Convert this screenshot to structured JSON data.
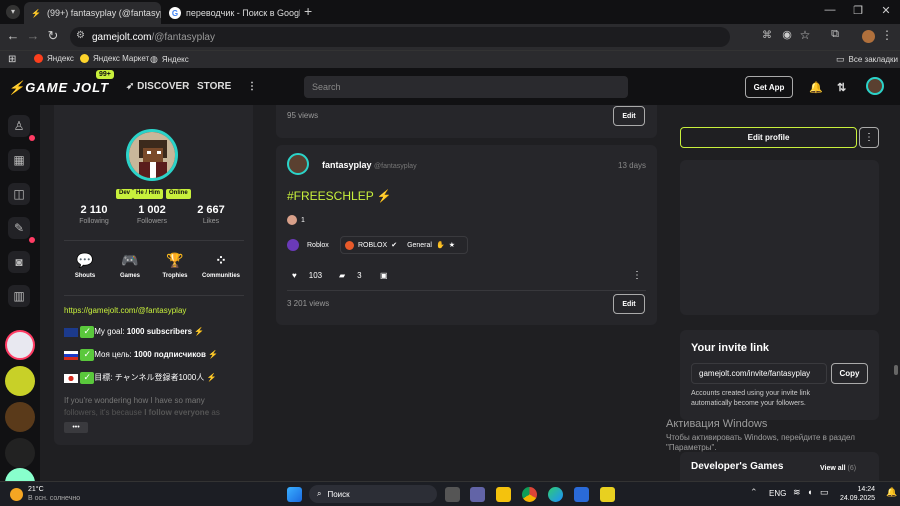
{
  "browser": {
    "tabs": [
      {
        "label": "(99+) fantasyplay (@fantasypla",
        "icon": "gamejolt-icon"
      },
      {
        "label": "переводчик - Поиск в Google",
        "icon": "google-icon"
      }
    ],
    "new_tab": "+",
    "url": "gamejolt.com/@fantasyplay",
    "url_host": "gamejolt.com",
    "url_path": "/@fantasyplay",
    "bookmarks": [
      "Яндекс",
      "Яндекс Маркет",
      "Яндекс"
    ],
    "all_bookmarks": "Все закладки"
  },
  "site": {
    "logo": "GAME JOLT",
    "logo_badge": "99+",
    "nav": [
      "DISCOVER",
      "STORE"
    ],
    "search_placeholder": "Search",
    "get_app": "Get App"
  },
  "profile": {
    "tags": [
      "Dev",
      "He / Him",
      "Online"
    ],
    "stats": [
      {
        "value": "2 110",
        "label": "Following"
      },
      {
        "value": "1 002",
        "label": "Followers"
      },
      {
        "value": "2 667",
        "label": "Likes"
      }
    ],
    "buttons": [
      "Shouts",
      "Games",
      "Trophies",
      "Communities"
    ],
    "link": "https://gamejolt.com/@fantasyplay",
    "bio_lines": [
      {
        "prefix": "My goal: ",
        "bold": "1000 subscribers"
      },
      {
        "prefix": "Моя цель: ",
        "bold": "1000 подписчиков"
      },
      {
        "prefix": "目標: ",
        "bold": "チャンネル登録者1000人"
      }
    ],
    "bio_more_1": "If you're wondering how I have so many",
    "bio_more_2a": "followers, it's because ",
    "bio_more_2b": "I follow everyone",
    "bio_more_2c": " as",
    "more_btn": "•••"
  },
  "feed": {
    "post0": {
      "views": "95 views",
      "edit": "Edit"
    },
    "post1": {
      "author": "fantasyplay",
      "handle": "@fantasyplay",
      "time": "13 days",
      "text": "#FREESCHLEP",
      "reaction_count": "1",
      "community_1": "Roblox",
      "community_2": "ROBLOX",
      "channel": "General",
      "likes": "103",
      "comments": "3",
      "views": "3 201 views",
      "edit": "Edit"
    }
  },
  "right": {
    "edit_profile": "Edit profile",
    "invite_title": "Your invite link",
    "invite_value": "gamejolt.com/invite/fantasyplay",
    "copy": "Copy",
    "invite_note": "Accounts created using your invite link automatically become your followers.",
    "dev_games_title": "Developer's Games",
    "view_all": "View all",
    "view_all_count": "(6)"
  },
  "activation": {
    "title": "Активация Windows",
    "line1": "Чтобы активировать Windows, перейдите в раздел",
    "line2": "\"Параметры\"."
  },
  "taskbar": {
    "weather_temp": "21°C",
    "weather_desc": "В осн. солнечно",
    "search": "Поиск",
    "lang": "ENG",
    "time": "14:24",
    "date": "24.09.2025"
  },
  "colors": {
    "accent": "#c8f03c",
    "teal": "#2bd3c9",
    "notif": "#ff3c64"
  }
}
